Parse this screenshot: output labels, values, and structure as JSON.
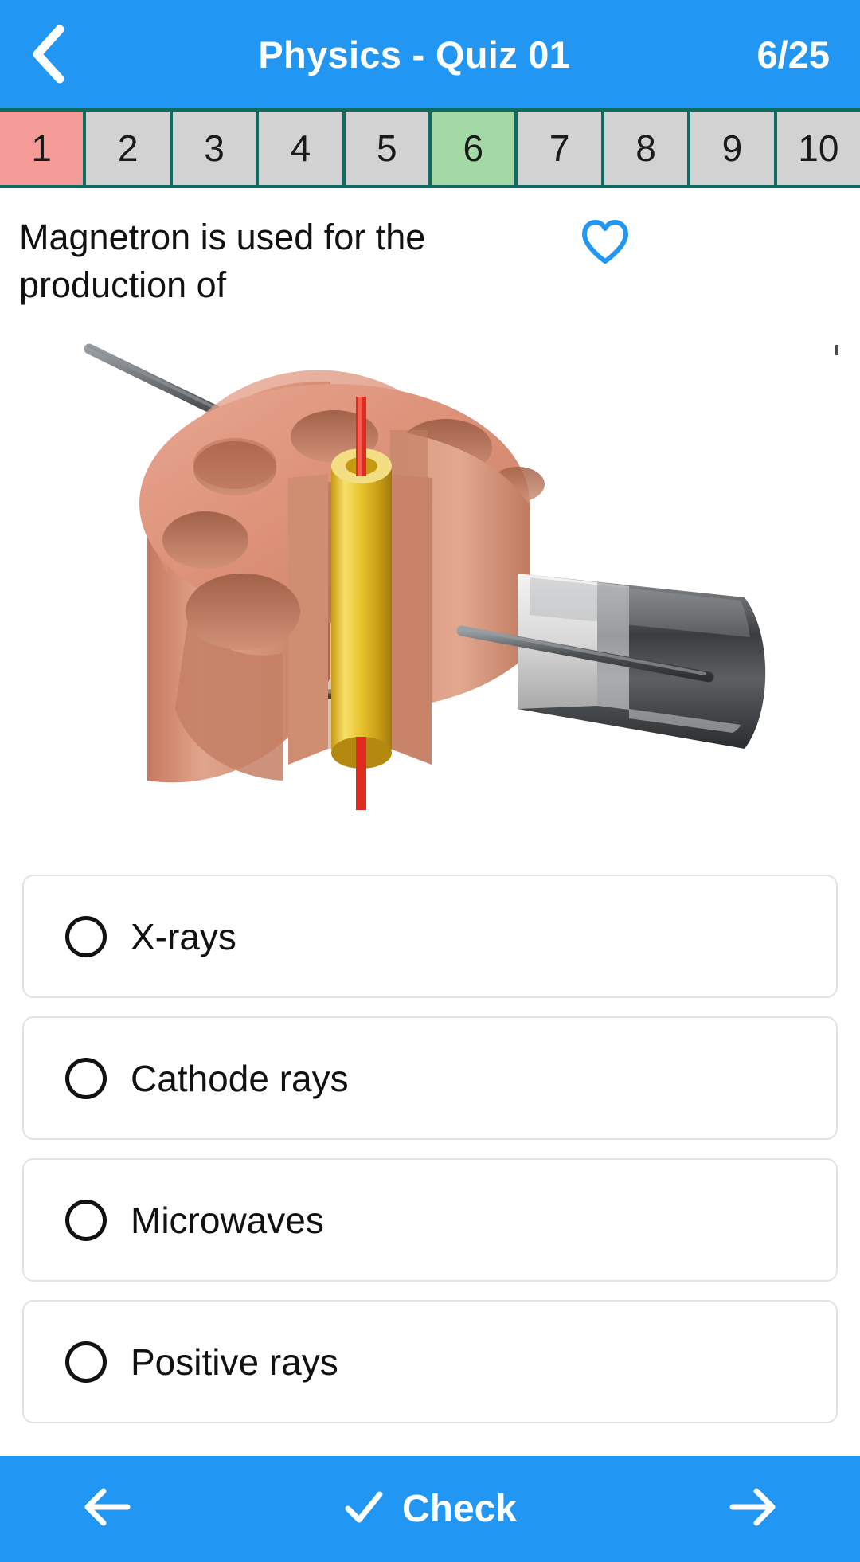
{
  "header": {
    "back_icon": "chevron-left-icon",
    "title": "Physics - Quiz 01",
    "counter": "6/25",
    "background_color": "#2196F3"
  },
  "question_nav": {
    "border_color": "#0E6B63",
    "default_color": "#D2D2D2",
    "wrong_color": "#F59B97",
    "current_color": "#A3D9A5",
    "items": [
      {
        "label": "1",
        "state": "wrong"
      },
      {
        "label": "2",
        "state": "default"
      },
      {
        "label": "3",
        "state": "default"
      },
      {
        "label": "4",
        "state": "default"
      },
      {
        "label": "5",
        "state": "default"
      },
      {
        "label": "6",
        "state": "current"
      },
      {
        "label": "7",
        "state": "default"
      },
      {
        "label": "8",
        "state": "default"
      },
      {
        "label": "9",
        "state": "default"
      },
      {
        "label": "10",
        "state": "default"
      }
    ]
  },
  "question": {
    "text": "Magnetron is used for the production of",
    "favorite_icon": "heart-outline-icon",
    "favorite_color": "#2196F3",
    "favorite_active": false,
    "image_alt": "magnetron-cutaway-diagram"
  },
  "options": [
    {
      "label": "X-rays",
      "selected": false
    },
    {
      "label": "Cathode rays",
      "selected": false
    },
    {
      "label": "Microwaves",
      "selected": false
    },
    {
      "label": "Positive rays",
      "selected": false
    }
  ],
  "bottom_bar": {
    "prev_icon": "arrow-left-icon",
    "check_icon": "check-icon",
    "check_label": "Check",
    "next_icon": "arrow-right-icon",
    "background_color": "#2196F3"
  }
}
